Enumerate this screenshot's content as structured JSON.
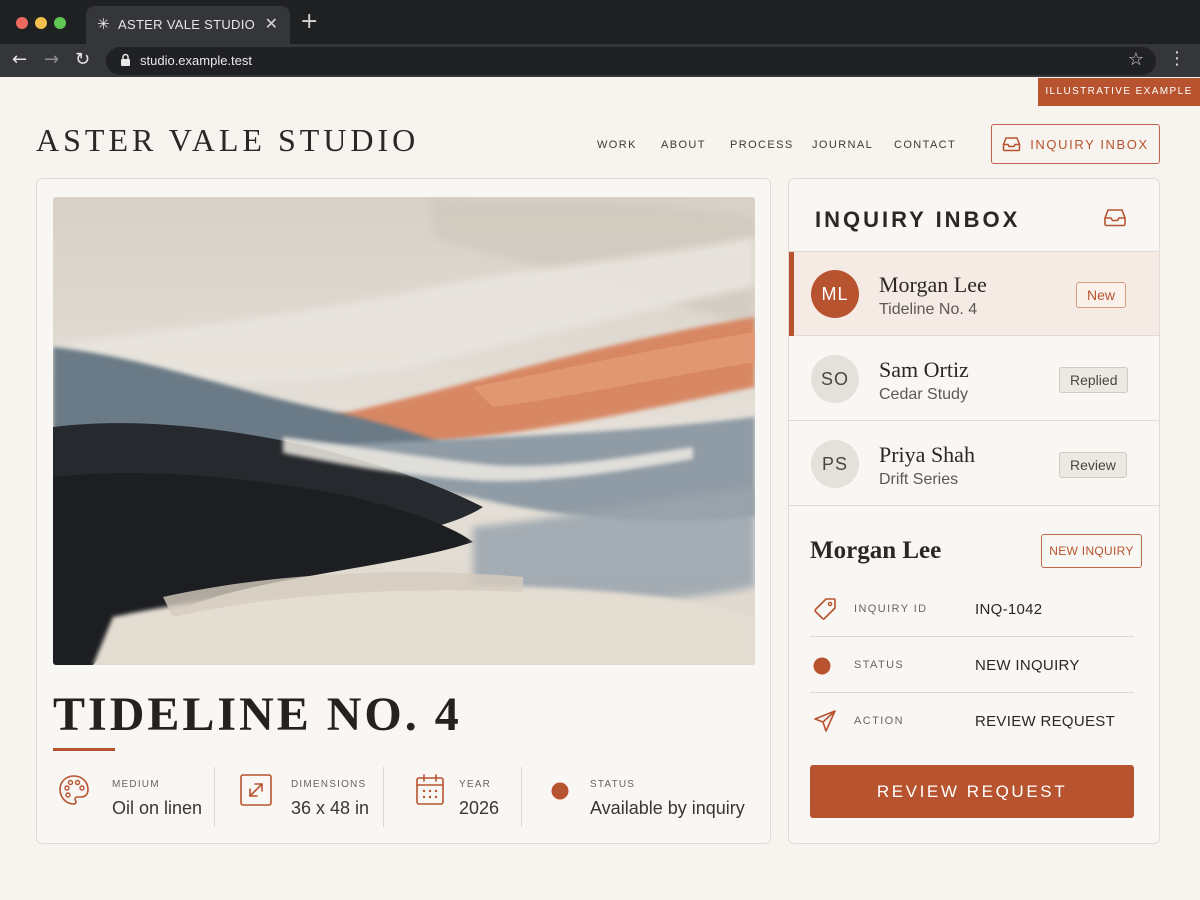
{
  "browser": {
    "tab_title": "ASTER VALE STUDIO",
    "url": "studio.example.test"
  },
  "ribbon": "ILLUSTRATIVE EXAMPLE",
  "header": {
    "brand": "ASTER VALE STUDIO",
    "nav": [
      "WORK",
      "ABOUT",
      "PROCESS",
      "JOURNAL",
      "CONTACT"
    ],
    "inbox_button": "INQUIRY INBOX"
  },
  "artwork": {
    "title": "TIDELINE NO. 4",
    "specs": [
      {
        "label": "MEDIUM",
        "value": "Oil on linen",
        "icon": "palette-icon"
      },
      {
        "label": "DIMENSIONS",
        "value": "36 x 48 in",
        "icon": "resize-icon"
      },
      {
        "label": "YEAR",
        "value": "2026",
        "icon": "calendar-icon"
      },
      {
        "label": "STATUS",
        "value": "Available by inquiry",
        "icon": "status-dot-icon"
      }
    ]
  },
  "inbox": {
    "title": "INQUIRY INBOX",
    "messages": [
      {
        "initials": "ML",
        "name": "Morgan Lee",
        "subject": "Tideline No. 4",
        "badge": "New"
      },
      {
        "initials": "SO",
        "name": "Sam Ortiz",
        "subject": "Cedar Study",
        "badge": "Replied"
      },
      {
        "initials": "PS",
        "name": "Priya Shah",
        "subject": "Drift Series",
        "badge": "Review"
      }
    ]
  },
  "detail": {
    "name": "Morgan Lee",
    "tag_button": "NEW INQUIRY",
    "rows": [
      {
        "label": "INQUIRY ID",
        "value": "INQ-1042",
        "icon": "tag-icon"
      },
      {
        "label": "STATUS",
        "value": "NEW INQUIRY",
        "icon": "status-dot-icon"
      },
      {
        "label": "ACTION",
        "value": "REVIEW REQUEST",
        "icon": "send-icon"
      }
    ],
    "primary_button": "REVIEW REQUEST"
  },
  "colors": {
    "accent": "#b8532f",
    "background": "#f7f4ef",
    "chrome": "#1f2022"
  }
}
